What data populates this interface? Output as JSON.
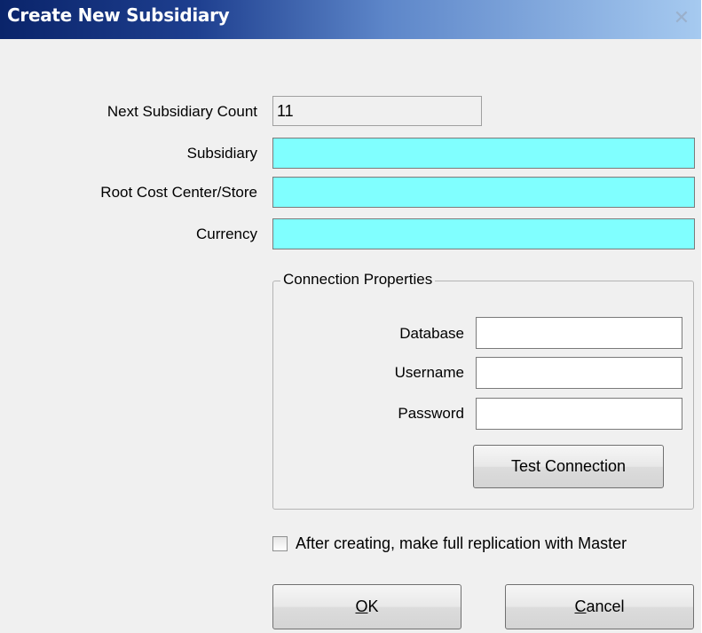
{
  "window": {
    "title": "Create New Subsidiary",
    "close_glyph": "✕"
  },
  "form": {
    "next_count_label": "Next Subsidiary Count",
    "next_count_value": "11",
    "subsidiary_label": "Subsidiary",
    "subsidiary_value": "",
    "root_cost_center_label": "Root Cost Center/Store",
    "root_cost_center_value": "",
    "currency_label": "Currency",
    "currency_value": ""
  },
  "connection": {
    "group_title": "Connection Properties",
    "database_label": "Database",
    "database_value": "",
    "username_label": "Username",
    "username_value": "",
    "password_label": "Password",
    "password_value": "",
    "test_button": "Test Connection"
  },
  "replication": {
    "checkbox_label": "After creating, make full replication with Master",
    "checked": false
  },
  "buttons": {
    "ok_accel": "O",
    "ok_rest": "K",
    "cancel_accel": "C",
    "cancel_rest": "ancel"
  },
  "colors": {
    "required_field": "#80ffff",
    "title_gradient_start": "#0a246a",
    "title_gradient_end": "#a6caf0",
    "dialog_bg": "#f0f0f0"
  }
}
